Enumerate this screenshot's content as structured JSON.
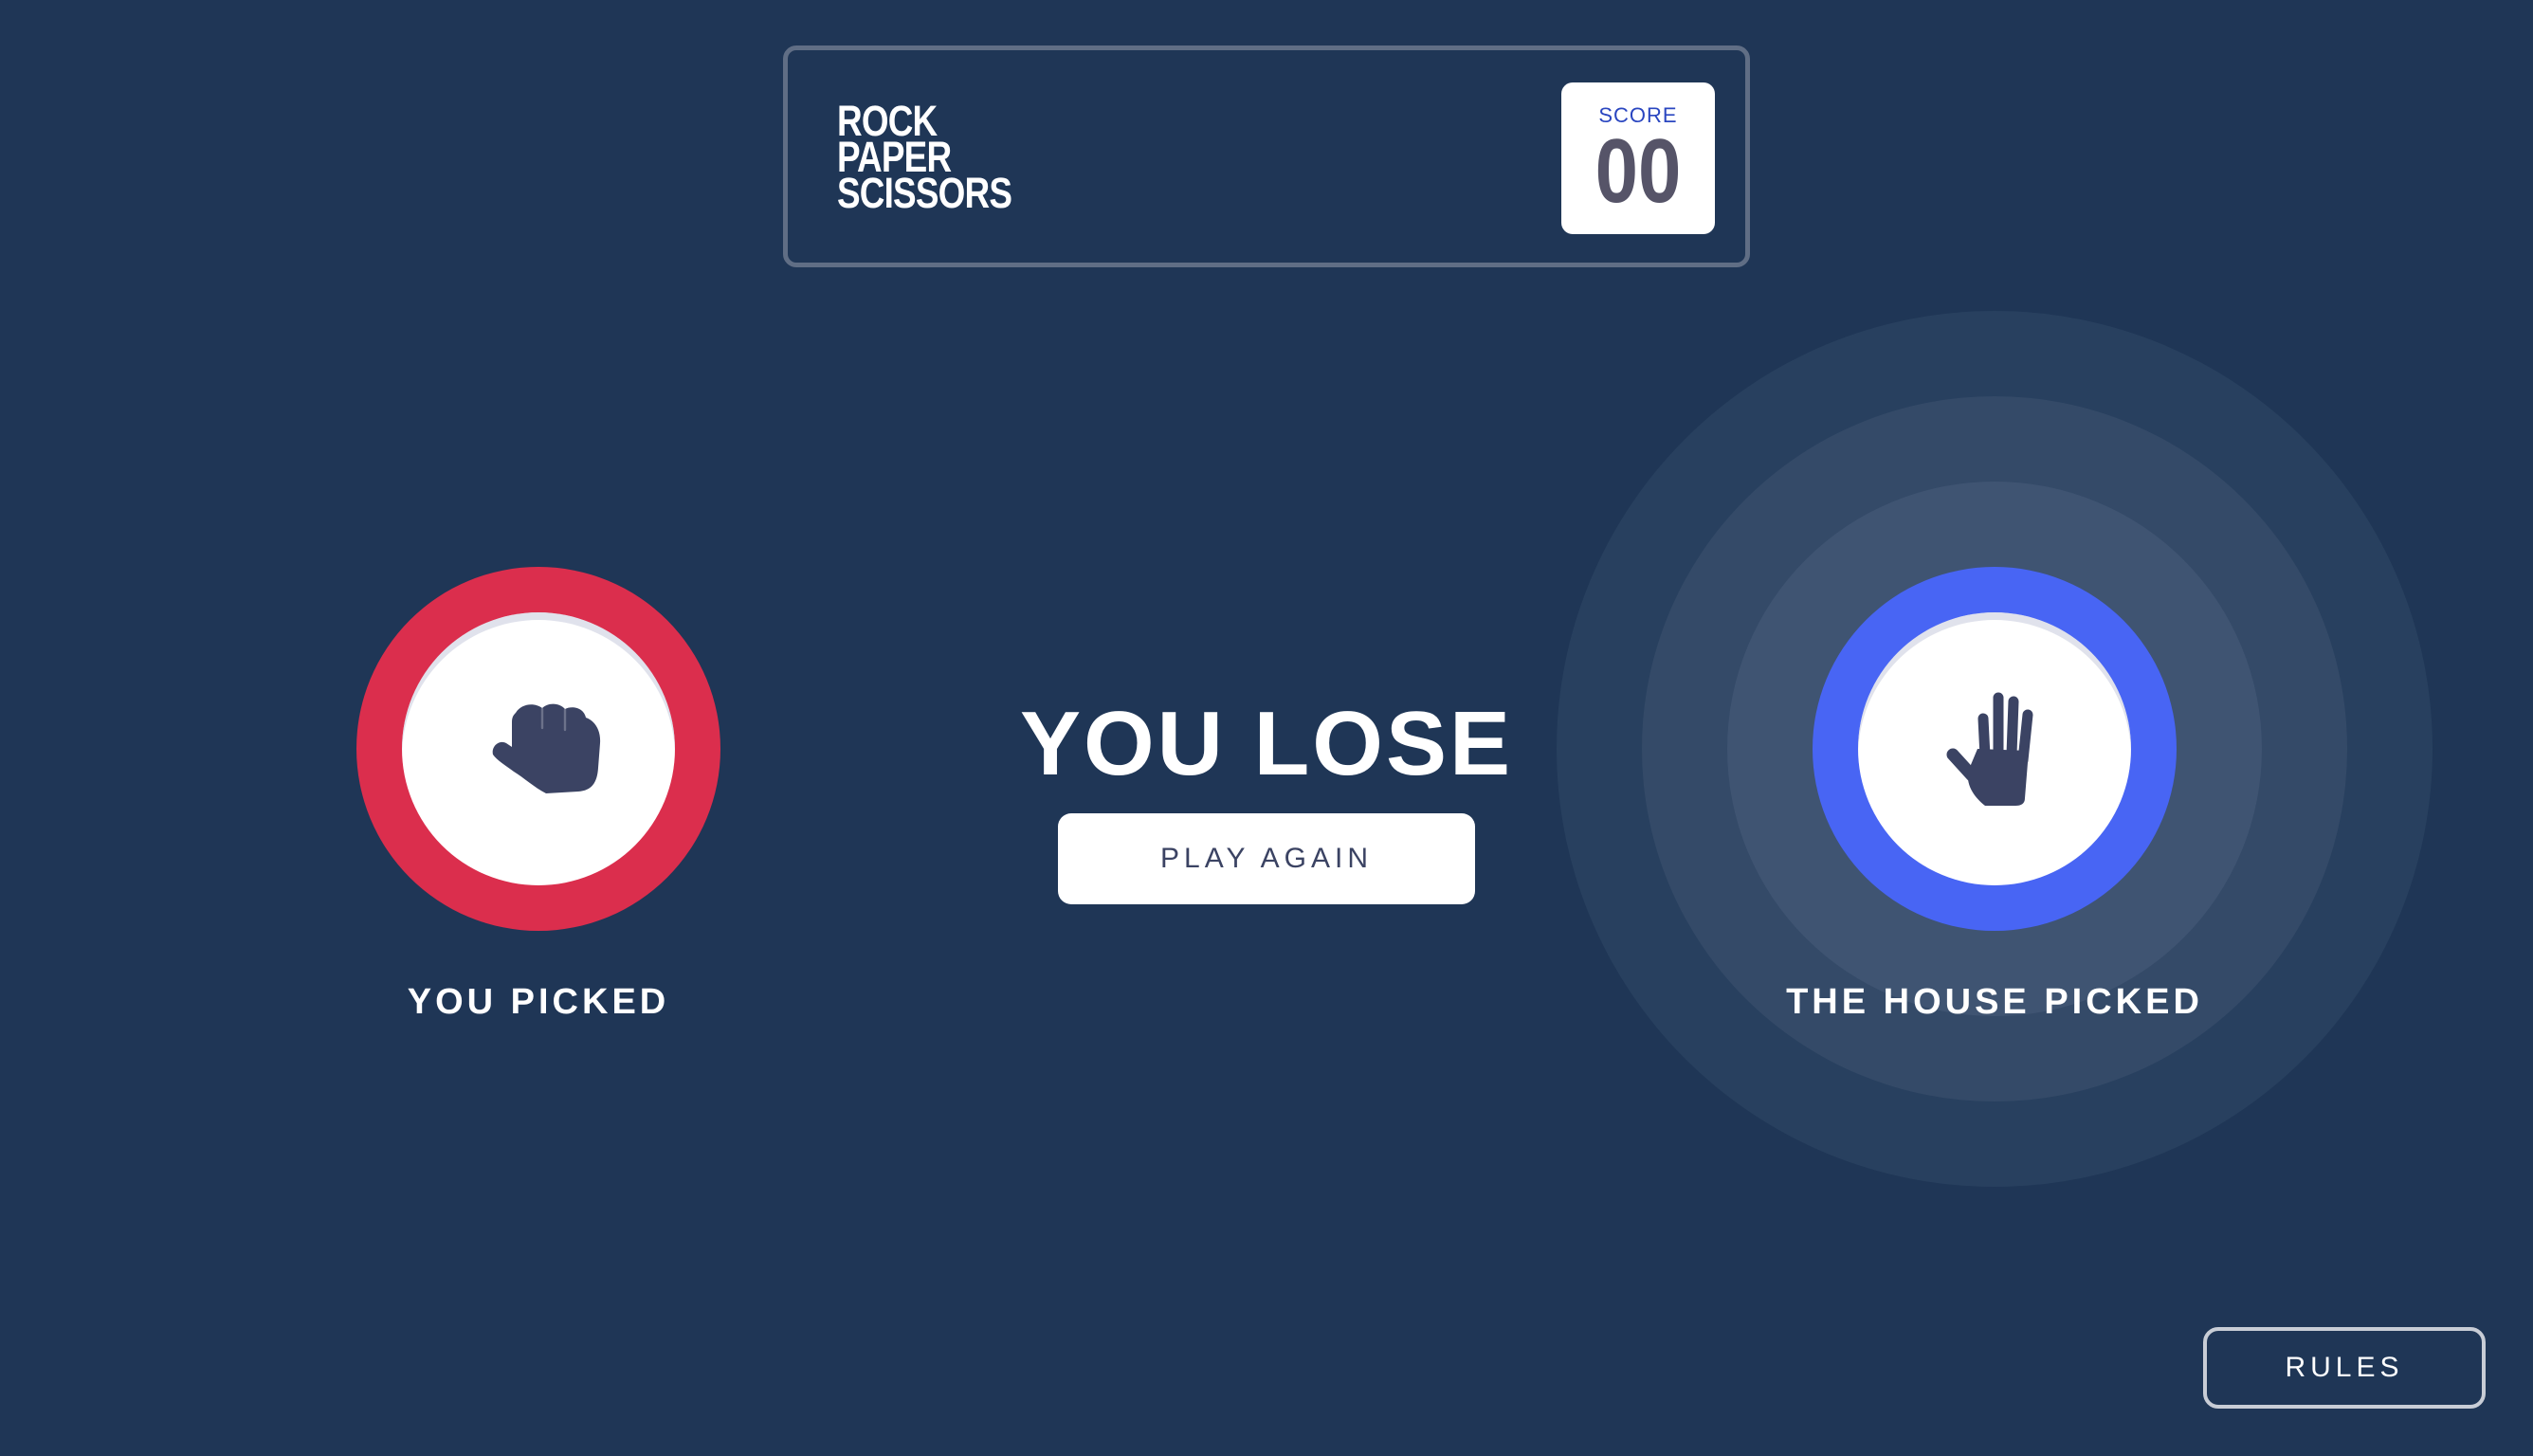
{
  "header": {
    "title_lines": [
      "ROCK",
      "PAPER",
      "SCISSORS"
    ],
    "score_label": "SCORE",
    "score_value": "00"
  },
  "player": {
    "label": "YOU PICKED",
    "choice_icon": "rock-icon",
    "ring_color": "#db2e4d"
  },
  "house": {
    "label": "THE HOUSE PICKED",
    "choice_icon": "paper-icon",
    "ring_color": "#4865f4"
  },
  "result": {
    "text": "YOU LOSE",
    "play_again_label": "PLAY AGAIN"
  },
  "footer": {
    "rules_label": "RULES"
  },
  "colors": {
    "background": "#1f3656",
    "header_border": "#606e85",
    "score_label": "#2a46c0",
    "score_value": "#565468",
    "icon": "#3b4363"
  }
}
